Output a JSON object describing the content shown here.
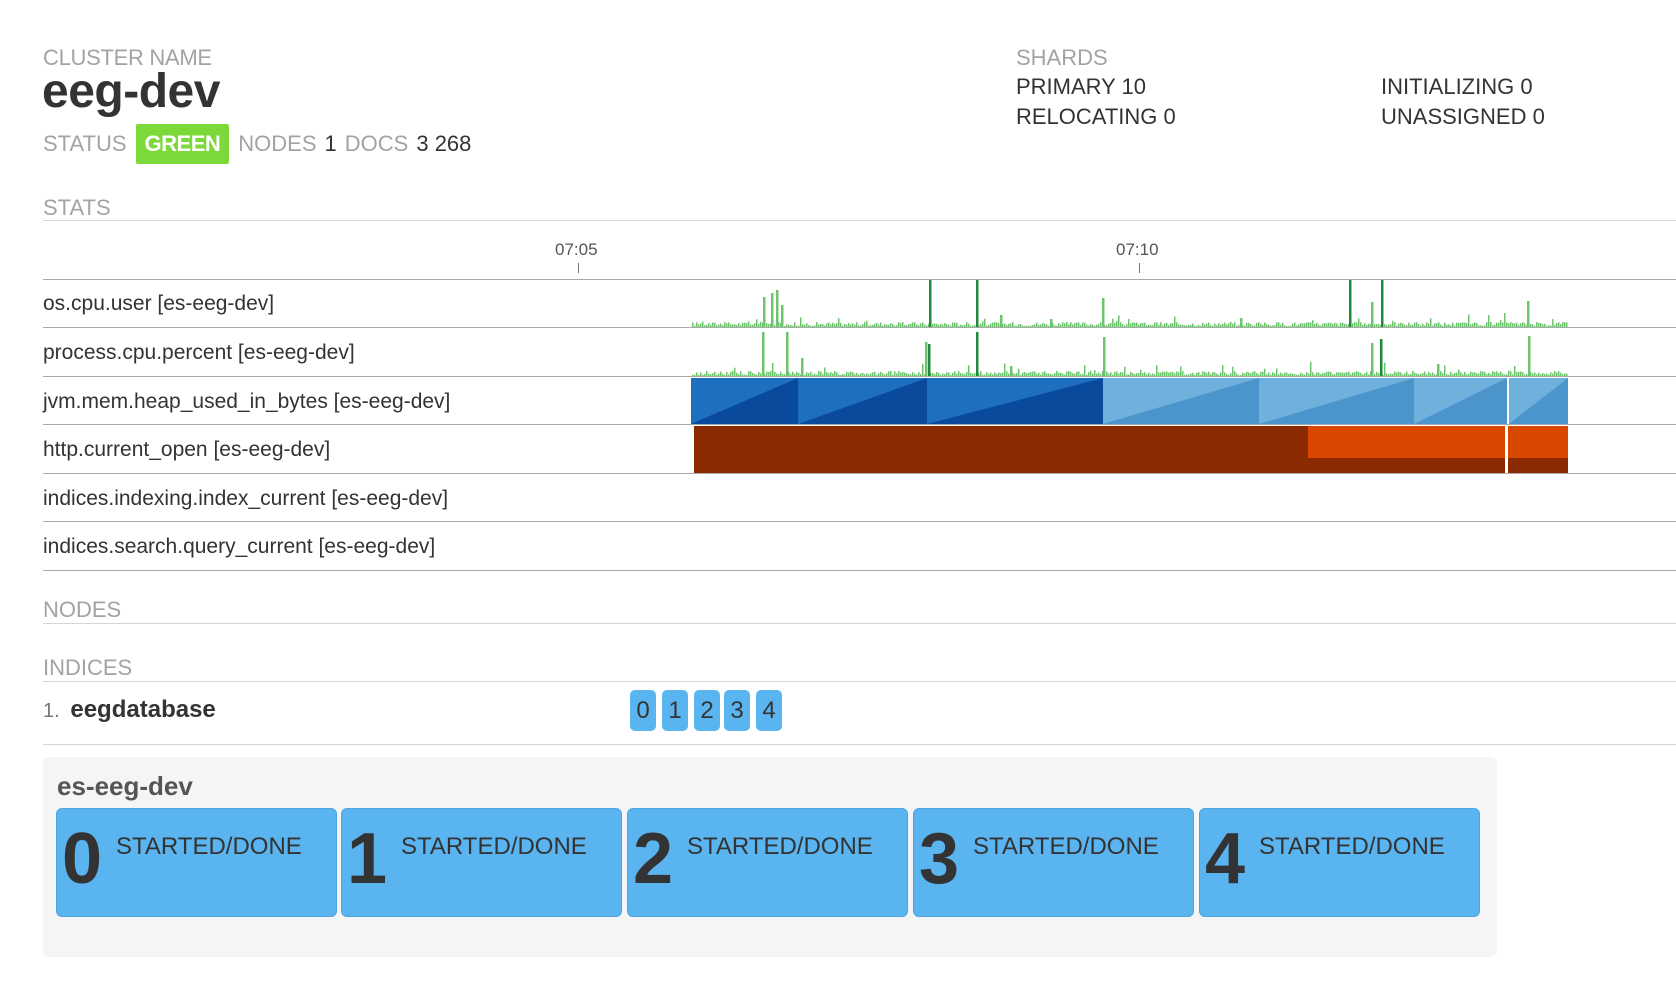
{
  "cluster": {
    "name_label": "CLUSTER NAME",
    "name": "eeg-dev",
    "status_label": "STATUS",
    "status": "GREEN",
    "nodes_label": "NODES",
    "nodes": "1",
    "docs_label": "DOCS",
    "docs": "3 268"
  },
  "shards": {
    "label": "SHARDS",
    "primary": "PRIMARY 10",
    "relocating": "RELOCATING 0",
    "initializing": "INITIALIZING 0",
    "unassigned": "UNASSIGNED 0"
  },
  "stats": {
    "label": "STATS",
    "ticks": [
      "07:05",
      "07:10"
    ],
    "metrics": [
      "os.cpu.user [es-eeg-dev]",
      "process.cpu.percent [es-eeg-dev]",
      "jvm.mem.heap_used_in_bytes [es-eeg-dev]",
      "http.current_open [es-eeg-dev]",
      "indices.indexing.index_current [es-eeg-dev]",
      "indices.search.query_current [es-eeg-dev]"
    ]
  },
  "nodes_section": {
    "label": "NODES"
  },
  "indices_section": {
    "label": "INDICES",
    "items": [
      {
        "number": "1.",
        "name": "eegdatabase",
        "shards": [
          "0",
          "1",
          "2",
          "3",
          "4"
        ]
      }
    ]
  },
  "node_panel": {
    "name": "es-eeg-dev",
    "shards": [
      {
        "id": "0",
        "state": "STARTED/DONE"
      },
      {
        "id": "1",
        "state": "STARTED/DONE"
      },
      {
        "id": "2",
        "state": "STARTED/DONE"
      },
      {
        "id": "3",
        "state": "STARTED/DONE"
      },
      {
        "id": "4",
        "state": "STARTED/DONE"
      }
    ]
  },
  "colors": {
    "status_green": "#7dd83a",
    "shard_blue": "#5ab4f0",
    "cpu_green": "#6cc46c",
    "cpu_dark_green": "#1f8a3a",
    "heap_dark": "#0a4a9c",
    "heap_mid": "#1e6fbf",
    "heap_light": "#6fb0dc",
    "http_dark": "#8b2a00",
    "http_orange": "#d94800"
  }
}
